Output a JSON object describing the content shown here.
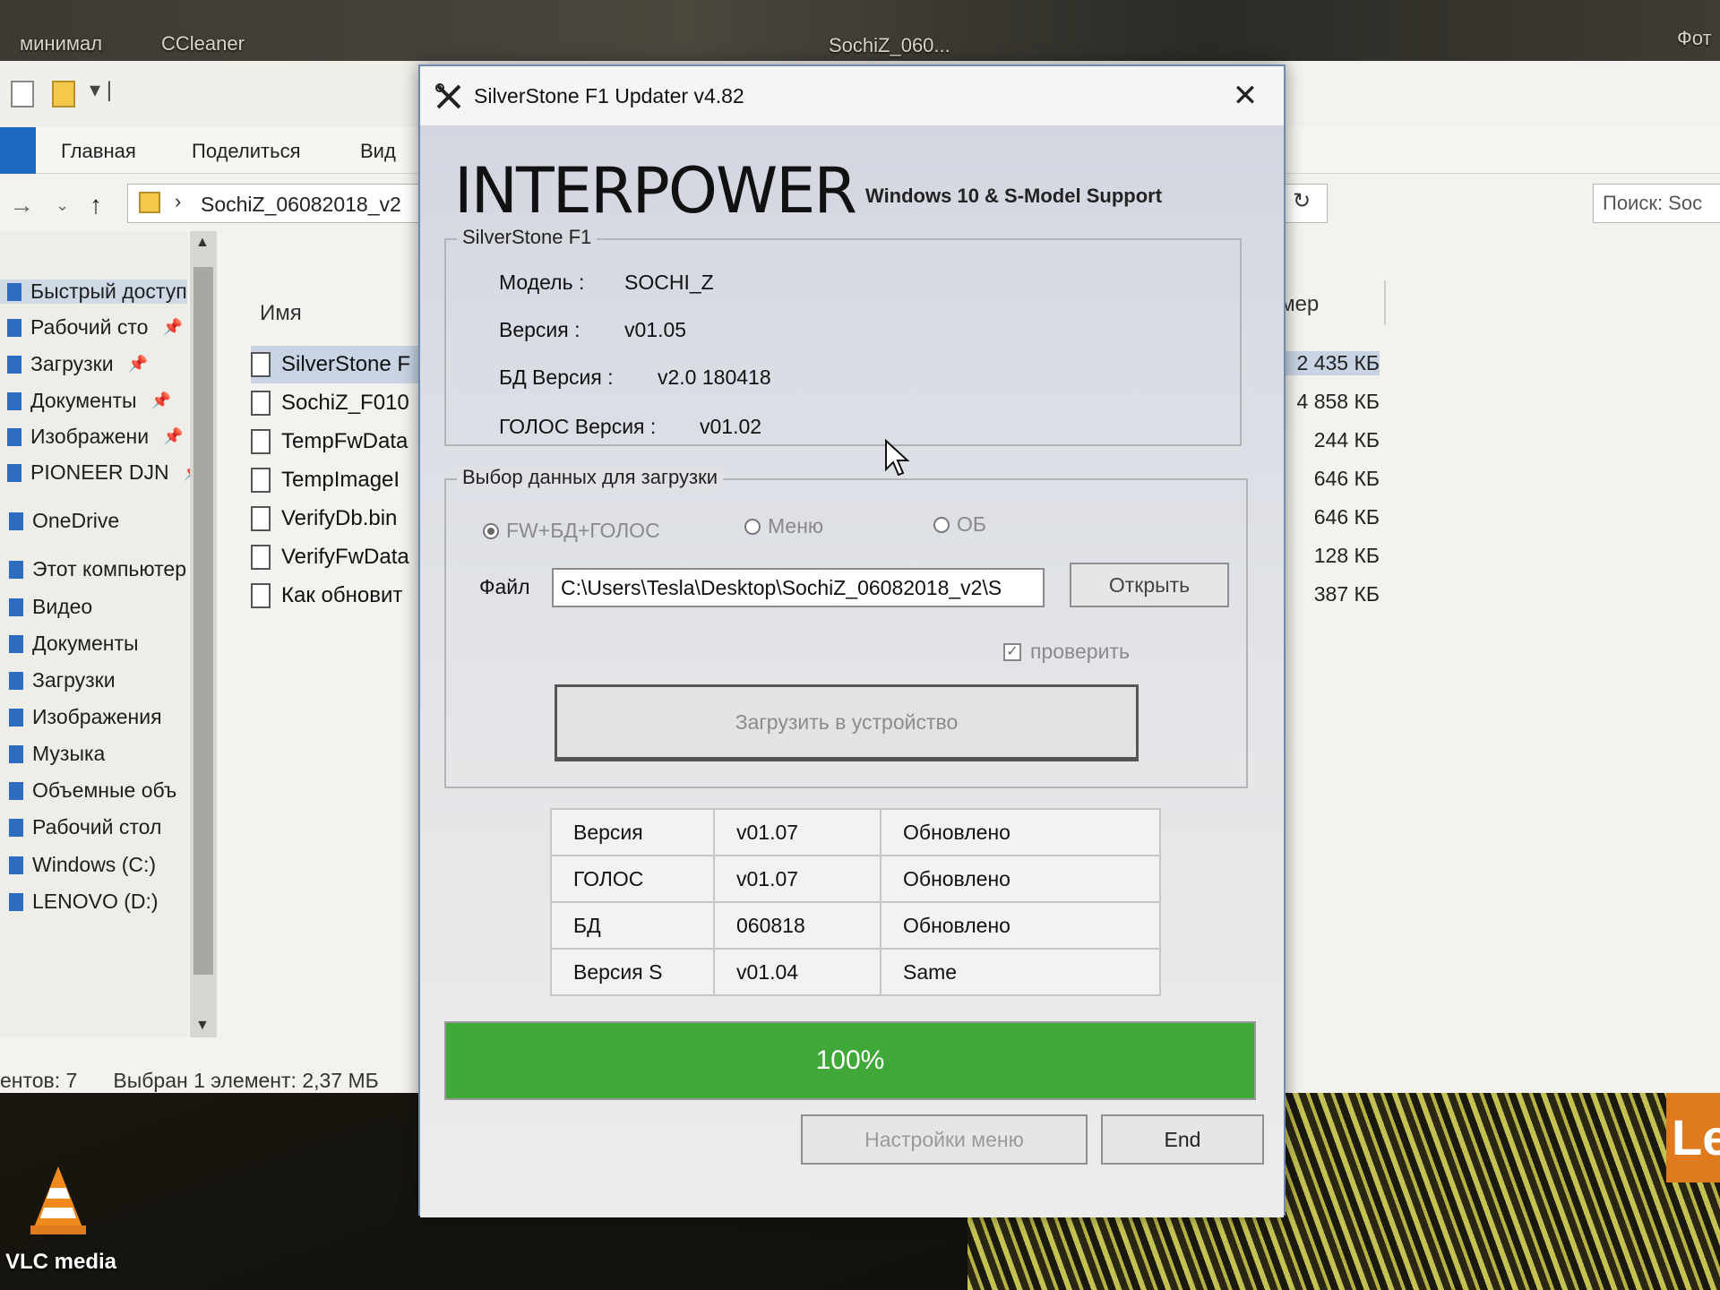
{
  "desktop": {
    "taskbar_labels": [
      "минимал",
      "CCleaner",
      "SochiZ_060...",
      "Фот"
    ],
    "vlc_label": "VLC media"
  },
  "explorer": {
    "ribbon_tabs": [
      "Главная",
      "Поделиться",
      "Вид"
    ],
    "address": "SochiZ_06082018_v2",
    "search_placeholder": "Поиск: Soc",
    "sidebar": [
      {
        "label": "Быстрый доступ",
        "pinned": false,
        "selected": true
      },
      {
        "label": "Рабочий сто",
        "pinned": true
      },
      {
        "label": "Загрузки",
        "pinned": true
      },
      {
        "label": "Документы",
        "pinned": true
      },
      {
        "label": "Изображени",
        "pinned": true
      },
      {
        "label": "PIONEER DJN",
        "pinned": true
      },
      {
        "label": "OneDrive",
        "pinned": false
      },
      {
        "label": "Этот компьютер",
        "pinned": false
      },
      {
        "label": "Видео",
        "pinned": false
      },
      {
        "label": "Документы",
        "pinned": false
      },
      {
        "label": "Загрузки",
        "pinned": false
      },
      {
        "label": "Изображения",
        "pinned": false
      },
      {
        "label": "Музыка",
        "pinned": false
      },
      {
        "label": "Объемные объ",
        "pinned": false
      },
      {
        "label": "Рабочий стол",
        "pinned": false
      },
      {
        "label": "Windows (C:)",
        "pinned": false
      },
      {
        "label": "LENOVO (D:)",
        "pinned": false
      }
    ],
    "columns": {
      "name": "Имя",
      "size": "азмер"
    },
    "files": [
      {
        "name": "SilverStone F",
        "size": "2 435 КБ",
        "selected": true
      },
      {
        "name": "SochiZ_F010",
        "size": "4 858 КБ"
      },
      {
        "name": "TempFwData",
        "size": "244 КБ"
      },
      {
        "name": "TempImageI",
        "size": "646 КБ"
      },
      {
        "name": "VerifyDb.bin",
        "size": "646 КБ"
      },
      {
        "name": "VerifyFwData",
        "size": "128 КБ"
      },
      {
        "name": "Как обновит",
        "size": "387 КБ"
      }
    ],
    "status": {
      "count": "ентов: 7",
      "selection": "Выбран 1 элемент: 2,37 МБ"
    }
  },
  "dialog": {
    "title": "SilverStone F1 Updater v4.82",
    "close_label": "✕",
    "logo": "INTERPOWER",
    "tagline": "Windows 10 & S-Model Support",
    "info_group": {
      "legend": "SilverStone F1",
      "model_label": "Модель :",
      "model_value": "SOCHI_Z",
      "version_label": "Версия :",
      "version_value": "v01.05",
      "db_label": "БД Версия :",
      "db_value": "v2.0 180418",
      "voice_label": "ГОЛОС Версия :",
      "voice_value": "v01.02"
    },
    "select_group": {
      "legend": "Выбор данных для загрузки",
      "radios": [
        {
          "label": "FW+БД+ГОЛОС",
          "checked": true
        },
        {
          "label": "Меню",
          "checked": false
        },
        {
          "label": "ОБ",
          "checked": false
        }
      ],
      "file_label": "Файл",
      "file_value": "C:\\Users\\Tesla\\Desktop\\SochiZ_06082018_v2\\S",
      "open_button": "Открыть",
      "verify_label": "проверить",
      "verify_checked": true,
      "upload_button": "Загрузить в устройство"
    },
    "results": [
      {
        "item": "Версия",
        "value": "v01.07",
        "status": "Обновлено"
      },
      {
        "item": "ГОЛОС",
        "value": "v01.07",
        "status": "Обновлено"
      },
      {
        "item": "БД",
        "value": "060818",
        "status": "Обновлено"
      },
      {
        "item": "Версия S",
        "value": "v01.04",
        "status": "Same"
      }
    ],
    "progress": {
      "value": 100,
      "label": "100%"
    },
    "menu_settings_button": "Настройки меню",
    "end_button": "End",
    "colors": {
      "progress": "#3fa838",
      "border": "#6f8ab0"
    }
  }
}
